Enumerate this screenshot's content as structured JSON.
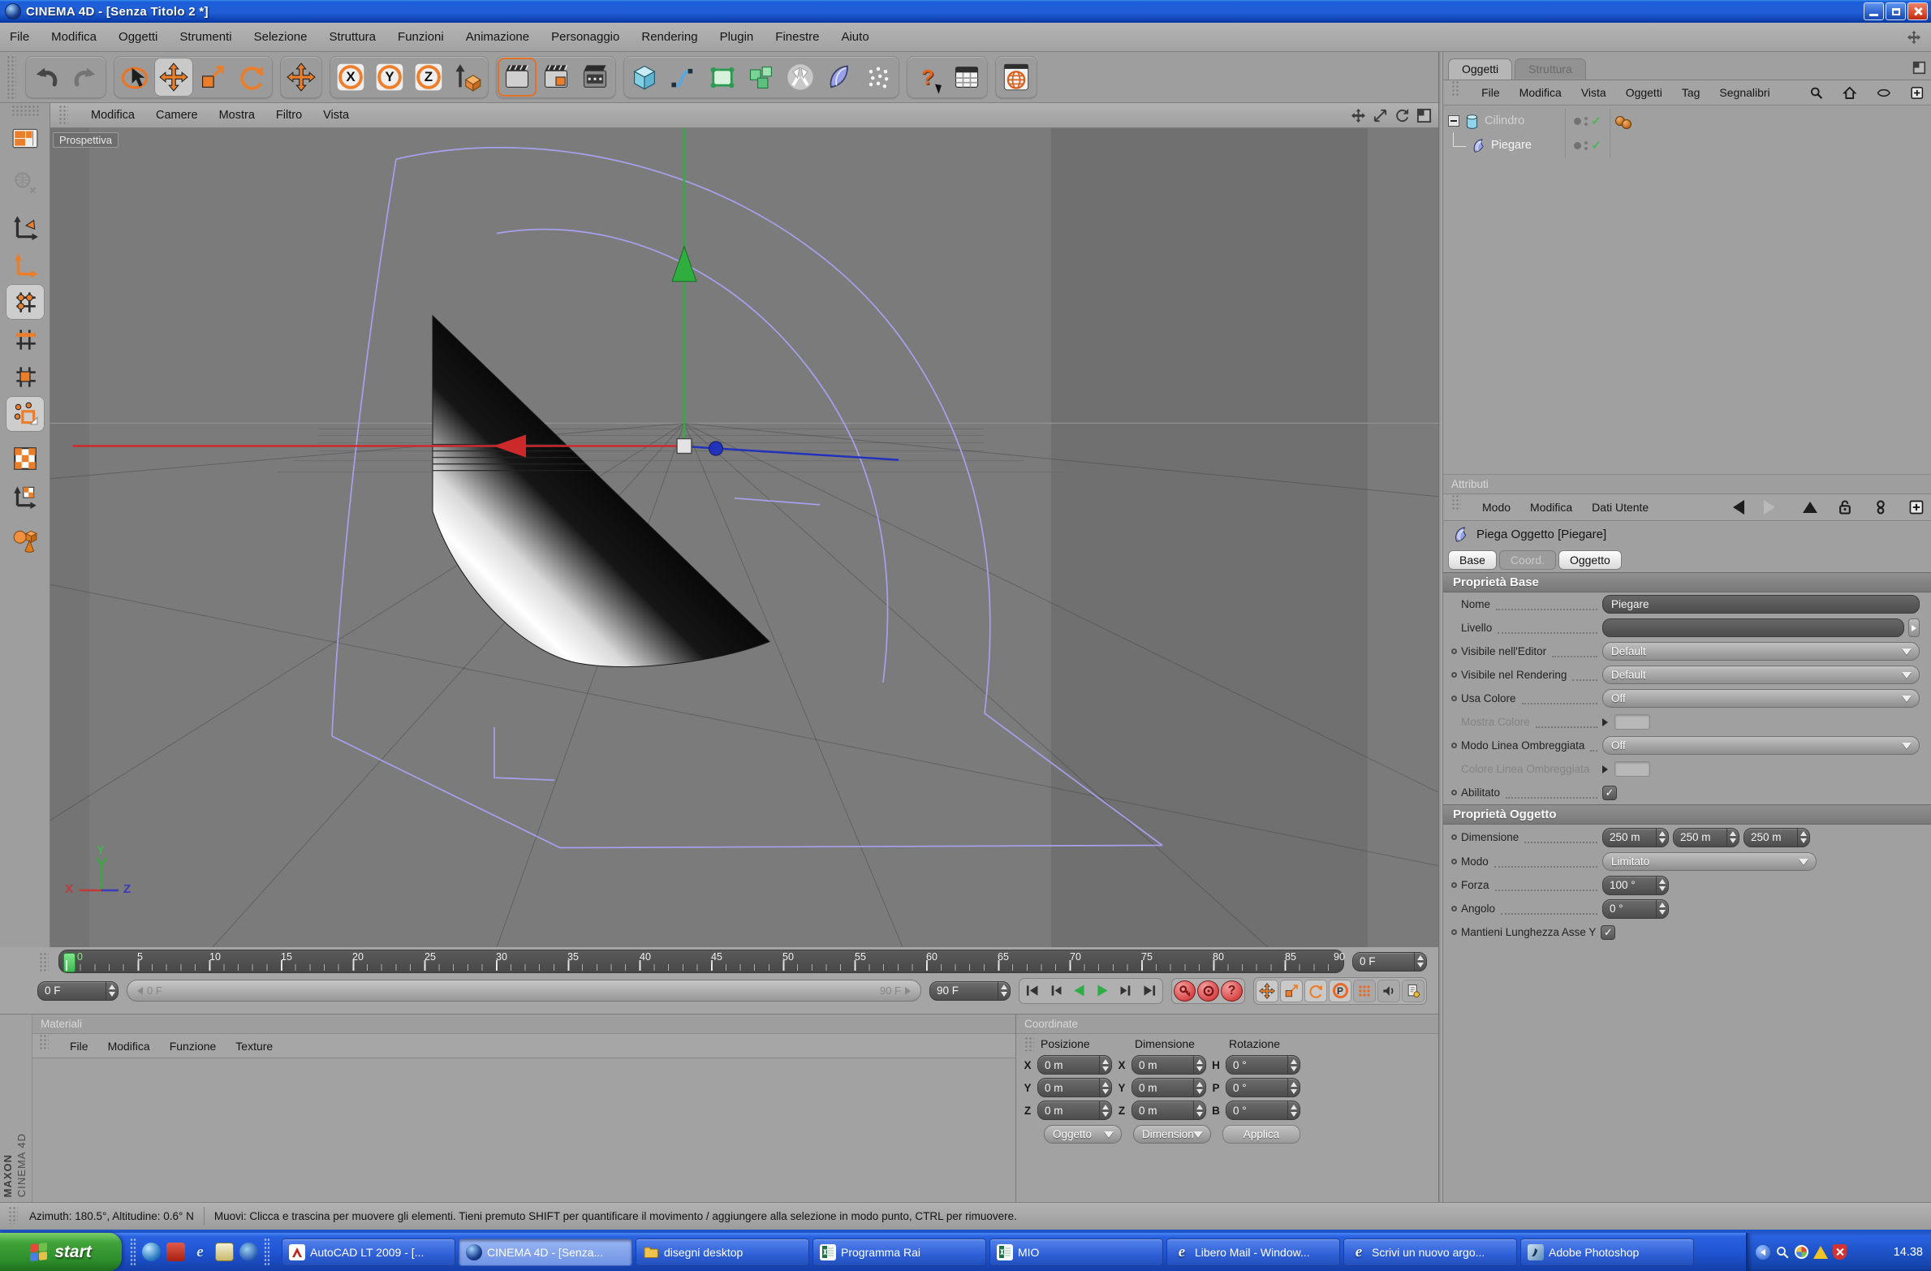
{
  "window": {
    "title": "CINEMA 4D - [Senza Titolo 2 *]"
  },
  "glyphs": {
    "check": "✓",
    "question": "?",
    "ie_letter": "e"
  },
  "menubar": {
    "items": [
      "File",
      "Modifica",
      "Oggetti",
      "Strumenti",
      "Selezione",
      "Struttura",
      "Funzioni",
      "Animazione",
      "Personaggio",
      "Rendering",
      "Plugin",
      "Finestre",
      "Aiuto"
    ]
  },
  "toolbar": {
    "axis_lock": [
      "X",
      "Y",
      "Z"
    ]
  },
  "viewport": {
    "menu": [
      "Modifica",
      "Camere",
      "Mostra",
      "Filtro",
      "Vista"
    ],
    "view_label": "Prospettiva",
    "axis_labels": {
      "x": "X",
      "y": "Y",
      "z": "Z"
    }
  },
  "object_manager": {
    "tabs": [
      {
        "label": "Oggetti"
      },
      {
        "label": "Struttura"
      }
    ],
    "menu": [
      "File",
      "Modifica",
      "Vista",
      "Oggetti",
      "Tag",
      "Segnalibri"
    ],
    "tree": [
      {
        "name": "Cilindro"
      },
      {
        "name": "Piegare"
      }
    ]
  },
  "attributes": {
    "title": "Attributi",
    "menu": [
      "Modo",
      "Modifica",
      "Dati Utente"
    ],
    "object_title": "Piega Oggetto [Piegare]",
    "tabs": [
      {
        "label": "Base"
      },
      {
        "label": "Coord."
      },
      {
        "label": "Oggetto"
      }
    ],
    "base_section": {
      "title": "Proprietà Base",
      "nome_label": "Nome",
      "nome_value": "Piegare",
      "livello_label": "Livello",
      "visibile_editor_label": "Visibile nell'Editor",
      "visibile_editor_value": "Default",
      "visibile_rendering_label": "Visibile nel Rendering",
      "visibile_rendering_value": "Default",
      "usa_colore_label": "Usa Colore",
      "usa_colore_value": "Off",
      "mostra_colore_label": "Mostra Colore",
      "modo_linea_label": "Modo Linea Ombreggiata",
      "modo_linea_value": "Off",
      "colore_linea_label": "Colore Linea Ombreggiata",
      "abilitato_label": "Abilitato"
    },
    "object_section": {
      "title": "Proprietà Oggetto",
      "dimensione_label": "Dimensione",
      "dimensione_values": [
        "250 m",
        "250 m",
        "250 m"
      ],
      "modo_label": "Modo",
      "modo_value": "Limitato",
      "forza_label": "Forza",
      "forza_value": "100 °",
      "angolo_label": "Angolo",
      "angolo_value": "0 °",
      "mantieni_label": "Mantieni Lunghezza Asse Y"
    }
  },
  "timeline": {
    "ticks": [
      "0",
      "5",
      "10",
      "15",
      "20",
      "25",
      "30",
      "35",
      "40",
      "45",
      "50",
      "55",
      "60",
      "65",
      "70",
      "75",
      "80",
      "85",
      "90"
    ],
    "ruler_field_value": "0 F",
    "current_frame_value": "0 F",
    "range_start_label": "0 F",
    "range_end_label": "90 F",
    "end_frame_value": "90 F"
  },
  "transport": {
    "parameter_letter": "P"
  },
  "materials": {
    "title": "Materiali",
    "menu": [
      "File",
      "Modifica",
      "Funzione",
      "Texture"
    ]
  },
  "coordinates": {
    "title": "Coordinate",
    "columns": [
      "Posizione",
      "Dimensione",
      "Rotazione"
    ],
    "rows": [
      {
        "pos_axis": "X",
        "pos_value": "0 m",
        "dim_axis": "X",
        "dim_value": "0 m",
        "rot_axis": "H",
        "rot_value": "0 °"
      },
      {
        "pos_axis": "Y",
        "pos_value": "0 m",
        "dim_axis": "Y",
        "dim_value": "0 m",
        "rot_axis": "P",
        "rot_value": "0 °"
      },
      {
        "pos_axis": "Z",
        "pos_value": "0 m",
        "dim_axis": "Z",
        "dim_value": "0 m",
        "rot_axis": "B",
        "rot_value": "0 °"
      }
    ],
    "target_dropdown": "Oggetto",
    "mode_dropdown": "Dimensione",
    "apply_button": "Applica"
  },
  "statusbar": {
    "camera_info": "Azimuth: 180.5°, Altitudine: 0.6°  N",
    "tool_hint": "Muovi: Clicca e trascina per muovere gli elementi. Tieni premuto SHIFT per quantificare il movimento / aggiungere alla selezione in modo punto, CTRL per rimuovere."
  },
  "branding": {
    "maxon": "MAXON",
    "app": "CINEMA 4D"
  },
  "taskbar": {
    "start_label": "start",
    "tasks": [
      {
        "label": "AutoCAD LT 2009 - [..."
      },
      {
        "label": "CINEMA 4D - [Senza..."
      },
      {
        "label": "disegni desktop"
      },
      {
        "label": "Programma Rai"
      },
      {
        "label": "MIO"
      },
      {
        "label": "Libero Mail - Window..."
      },
      {
        "label": "Scrivi un nuovo argo..."
      },
      {
        "label": "Adobe Photoshop"
      }
    ],
    "clock": "14.38"
  }
}
